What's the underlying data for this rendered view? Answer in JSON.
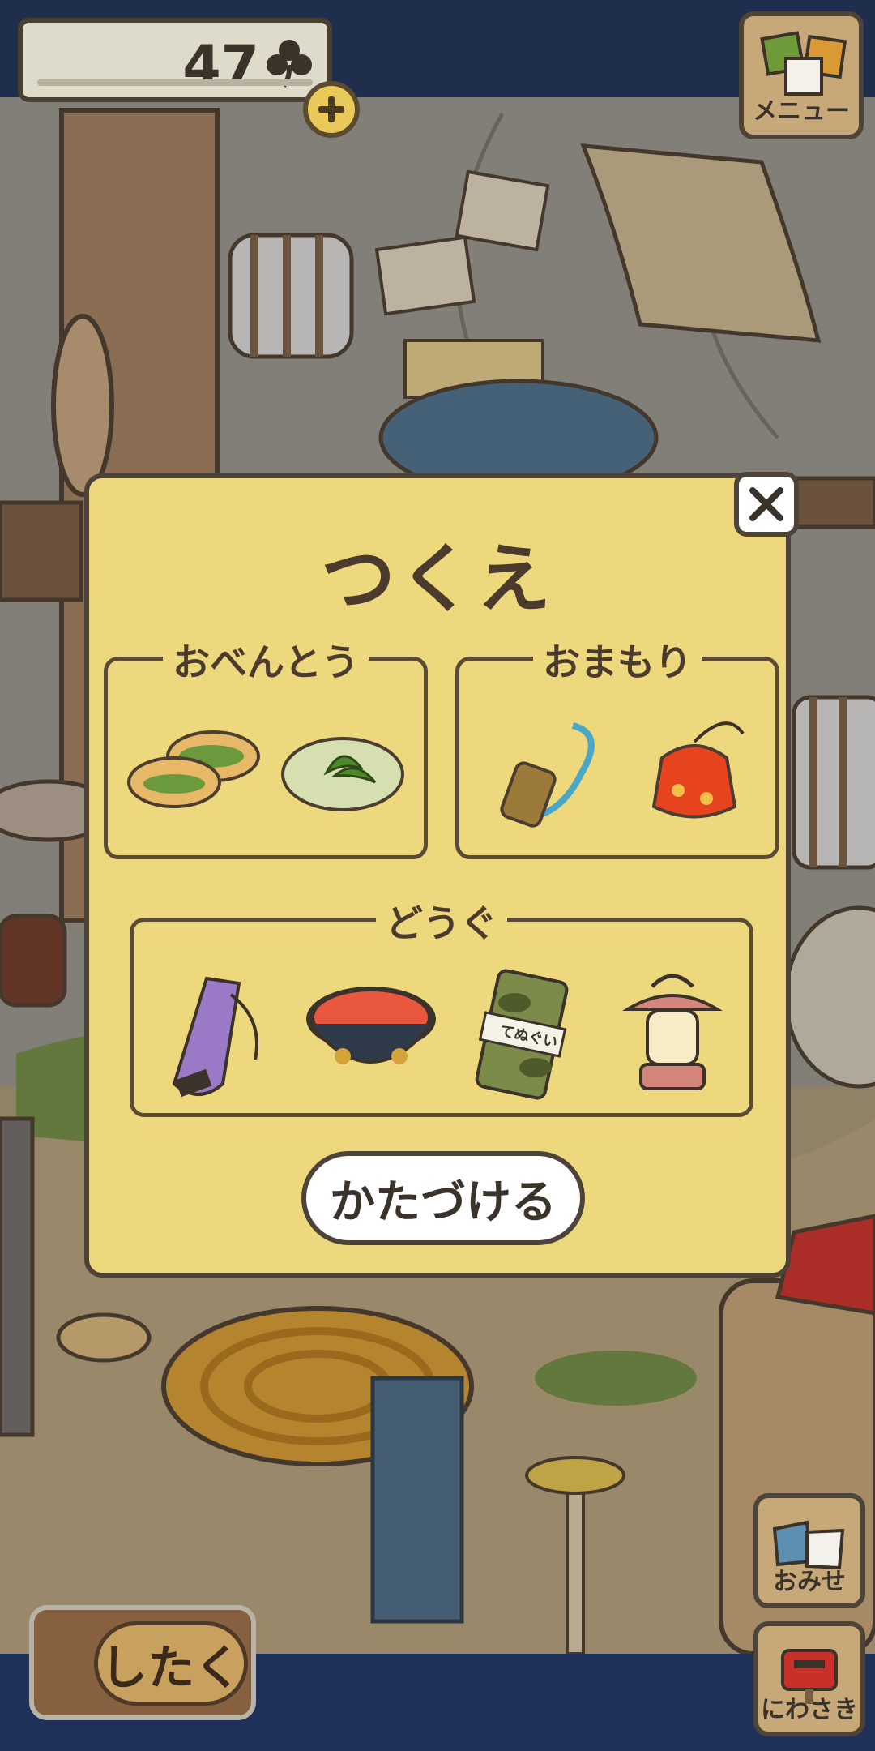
{
  "hud": {
    "clover_count": "47",
    "clover_icon": "clover-icon",
    "plus_icon": "plus-icon"
  },
  "menu_button": {
    "label": "メニュー",
    "icon": "papers-icon"
  },
  "side_buttons": [
    {
      "label": "おみせ",
      "icon": "shop-bags-icon"
    },
    {
      "label": "にわさき",
      "icon": "mailbox-icon"
    }
  ],
  "pack_button": {
    "label": "したく"
  },
  "dialog": {
    "title": "つくえ",
    "close_icon": "close-icon",
    "groups": [
      {
        "label": "おべんとう",
        "items": [
          "bread-sandwich-icon",
          "herb-pancake-icon"
        ]
      },
      {
        "label": "おまもり",
        "items": [
          "bell-charm-icon",
          "red-pouch-charm-icon"
        ]
      },
      {
        "label": "どうぐ",
        "items": [
          "purple-bag-icon",
          "red-bowl-icon",
          "camo-tenugui-icon",
          "lantern-icon"
        ]
      }
    ],
    "tenugui_text": "てぬぐい",
    "tidy_button": "かたづける"
  },
  "colors": {
    "frame": "#1f3158",
    "dialog_bg": "#eed87d",
    "outline": "#4d4339"
  }
}
